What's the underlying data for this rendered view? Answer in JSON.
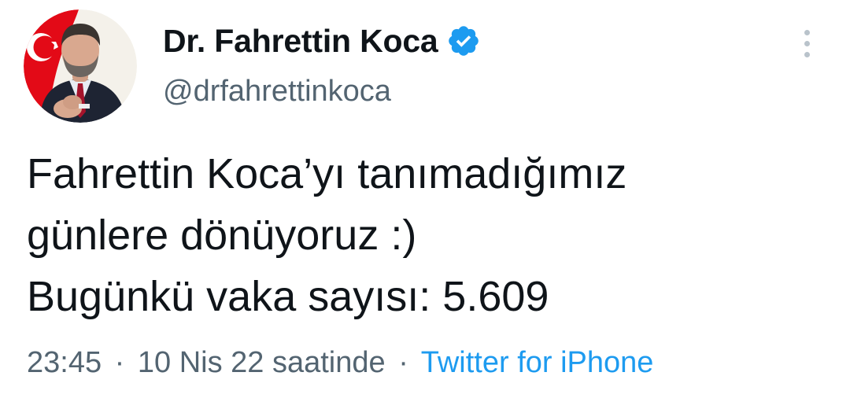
{
  "author": {
    "display_name": "Dr. Fahrettin Koca",
    "handle": "@drfahrettinkoca",
    "verified": true,
    "avatar_icon": "profile-photo"
  },
  "tweet": {
    "lines": [
      "Fahrettin Koca’yı tanımadığımız",
      "günlere dönüyoruz :)",
      "Bugünkü vaka sayısı: 5.609"
    ]
  },
  "meta": {
    "time": "23:45",
    "separator": "·",
    "date": "10 Nis 22 saatinde",
    "source": "Twitter for iPhone"
  },
  "colors": {
    "text": "#0f1419",
    "secondary": "#536471",
    "link": "#1d9bf0",
    "verified": "#1d9bf0",
    "flag_red": "#e30a17"
  },
  "icons": {
    "verified": "verified-badge-icon",
    "more": "more-vertical-icon"
  }
}
